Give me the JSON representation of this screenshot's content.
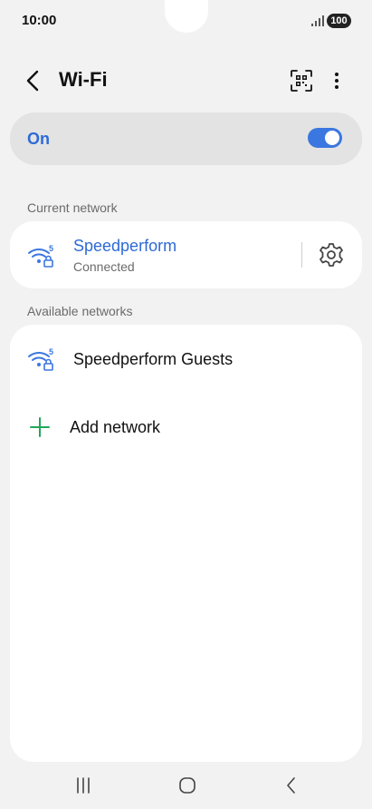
{
  "status": {
    "time": "10:00",
    "battery": "100"
  },
  "header": {
    "title": "Wi-Fi"
  },
  "wifi_toggle": {
    "label": "On",
    "state": "on"
  },
  "current_network": {
    "section_label": "Current network",
    "name": "Speedperform",
    "status": "Connected"
  },
  "available_networks": {
    "section_label": "Available networks",
    "items": [
      {
        "name": "Speedperform Guests"
      }
    ],
    "add_label": "Add network"
  },
  "colors": {
    "accent": "#3b77e0",
    "accent_text": "#2e6ad6",
    "add_green": "#1fa65a",
    "background": "#f2f2f2",
    "card": "#ffffff"
  },
  "icons": {
    "back": "chevron-left-icon",
    "qr": "qr-scan-icon",
    "more": "more-vertical-icon",
    "wifi": "wifi-secured-5ghz-icon",
    "settings": "gear-icon",
    "add": "plus-icon"
  }
}
